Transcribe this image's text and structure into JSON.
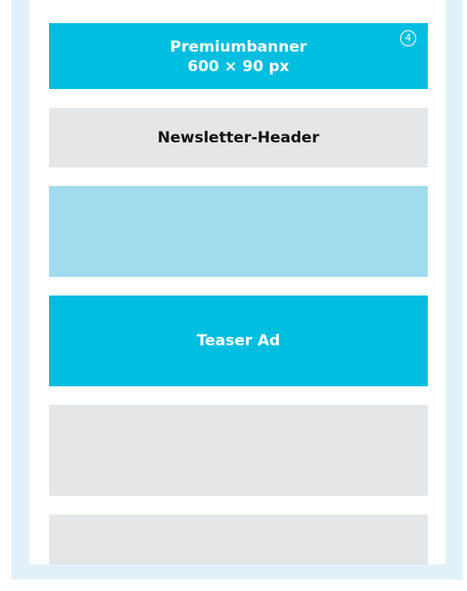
{
  "premium_banner": {
    "title": "Premiumbanner",
    "size": "600 × 90 px",
    "marker": "4",
    "color": "#00bee0"
  },
  "newsletter_header": {
    "label": "Newsletter-Header",
    "color": "#e5e6e8"
  },
  "teaser_ad": {
    "label": "Teaser Ad",
    "color": "#00bee0"
  },
  "colors": {
    "frame": "#e2f1f9",
    "light_block": "#a0dcee",
    "gray_block": "#e5e6e8"
  }
}
